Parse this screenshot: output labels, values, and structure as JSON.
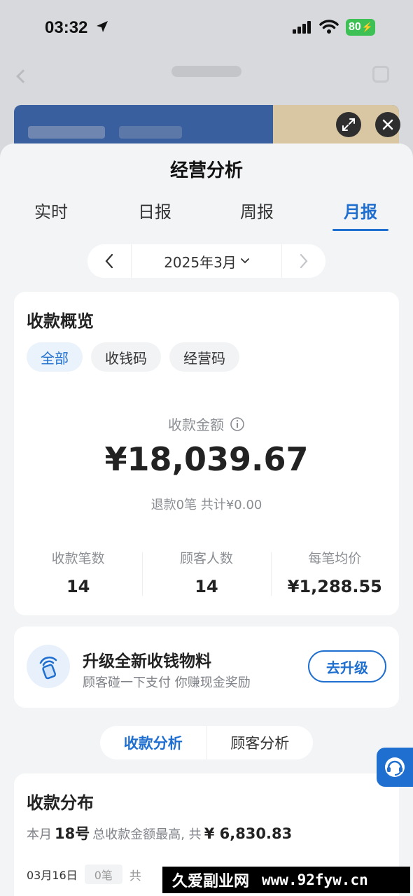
{
  "status_bar": {
    "time": "03:32",
    "battery": "80"
  },
  "sheet": {
    "title": "经营分析",
    "tabs": [
      {
        "label": "实时"
      },
      {
        "label": "日报"
      },
      {
        "label": "周报"
      },
      {
        "label": "月报",
        "active": true
      }
    ],
    "month_picker": {
      "label": "2025年3月"
    }
  },
  "overview": {
    "title": "收款概览",
    "chips": [
      {
        "label": "全部",
        "active": true
      },
      {
        "label": "收钱码"
      },
      {
        "label": "经营码"
      }
    ],
    "amount_label": "收款金额",
    "amount": "¥18,039.67",
    "refund": "退款0笔 共计¥0.00",
    "stats": [
      {
        "label": "收款笔数",
        "value": "14"
      },
      {
        "label": "顾客人数",
        "value": "14"
      },
      {
        "label": "每笔均价",
        "value": "¥1,288.55"
      }
    ]
  },
  "upgrade": {
    "title": "升级全新收钱物料",
    "desc": "顾客碰一下支付 你赚现金奖励",
    "button": "去升级"
  },
  "analysis_tabs": [
    {
      "label": "收款分析",
      "active": true
    },
    {
      "label": "顾客分析"
    }
  ],
  "distribution": {
    "title": "收款分布",
    "summary_prefix": "本月",
    "summary_day": "18号",
    "summary_mid": "总收款金额最高, 共",
    "summary_amount": "¥ 6,830.83",
    "row": {
      "date": "03月16日",
      "count": "0笔",
      "total": "共"
    }
  },
  "watermark": {
    "cn": "久爱副业网",
    "url": "www.92fyw.cn"
  },
  "colors": {
    "accent": "#1f6fd0",
    "battery": "#3dc154"
  }
}
